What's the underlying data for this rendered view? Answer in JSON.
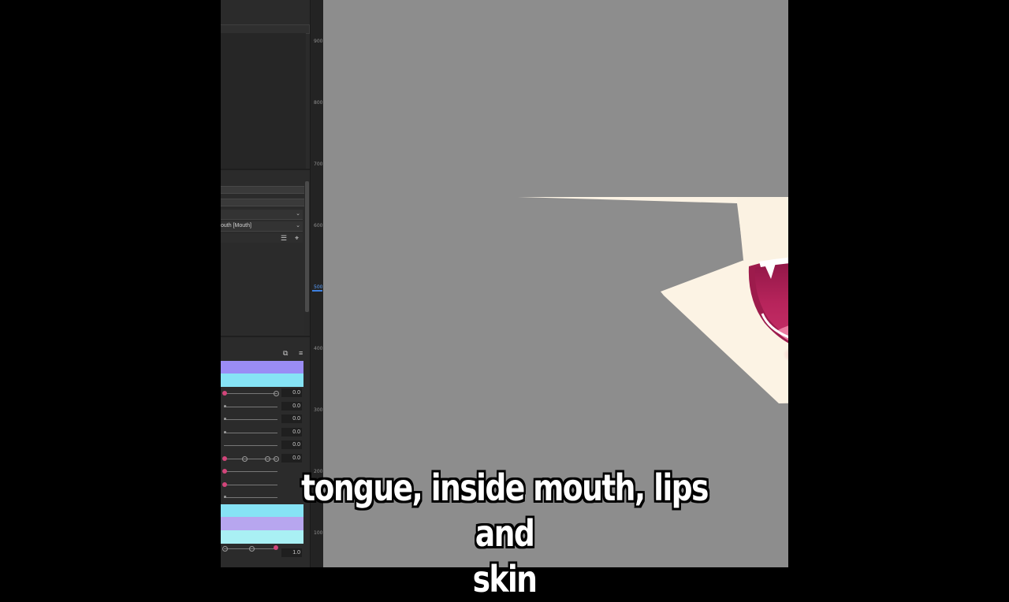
{
  "panel": {
    "layer_label": "outh  [Mouth]",
    "parameters": [
      {
        "value": "0.0",
        "knob": "pink"
      },
      {
        "value": "0.0",
        "knob": "grey"
      },
      {
        "value": "0.0",
        "knob": "grey"
      },
      {
        "value": "0.0",
        "knob": "grey"
      },
      {
        "value": "0.0",
        "knob": "none"
      },
      {
        "value": "0.0",
        "knob": "pink-multi"
      },
      {
        "value": "",
        "knob": "pink"
      },
      {
        "value": "",
        "knob": "pink"
      },
      {
        "value": "",
        "knob": "grey"
      }
    ],
    "bottom_param_value": "1.0",
    "band_colors": {
      "purple": "#9a8cf5",
      "cyan": "#86e3f5",
      "lavender": "#b7a6ef"
    }
  },
  "ruler": {
    "labels": [
      "900",
      "800",
      "700",
      "600",
      "500",
      "400",
      "300",
      "200",
      "100"
    ],
    "active_label": "500"
  },
  "canvas": {
    "background": "#8d8d8d",
    "skin_color": "#fcf3e4",
    "mouth_color": "#b7245b",
    "tongue_color": "#ea7aa0"
  },
  "subtitle": {
    "line1": "tongue, inside mouth, lips and",
    "line2": "skin"
  }
}
